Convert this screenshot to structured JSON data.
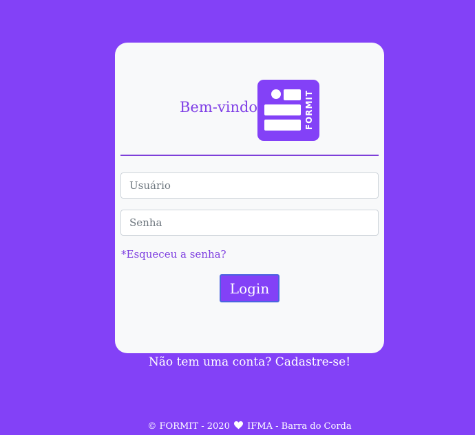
{
  "login": {
    "welcome_text": "Bem-vindo!",
    "logo_text": "FORMIT",
    "username_placeholder": "Usuário",
    "password_placeholder": "Senha",
    "forgot_password": "*Esqueceu a senha?",
    "login_button": "Login",
    "signup_prompt": "Não tem uma conta? Cadastre-se!"
  },
  "footer": {
    "left": "© FORMIT - 2020",
    "right": "IFMA - Barra do Corda",
    "icon": "heart-icon"
  },
  "colors": {
    "background": "#8341f7",
    "card": "#f8f9fa",
    "accent_text": "#7f3fe6",
    "button_border": "#4a63e0"
  }
}
